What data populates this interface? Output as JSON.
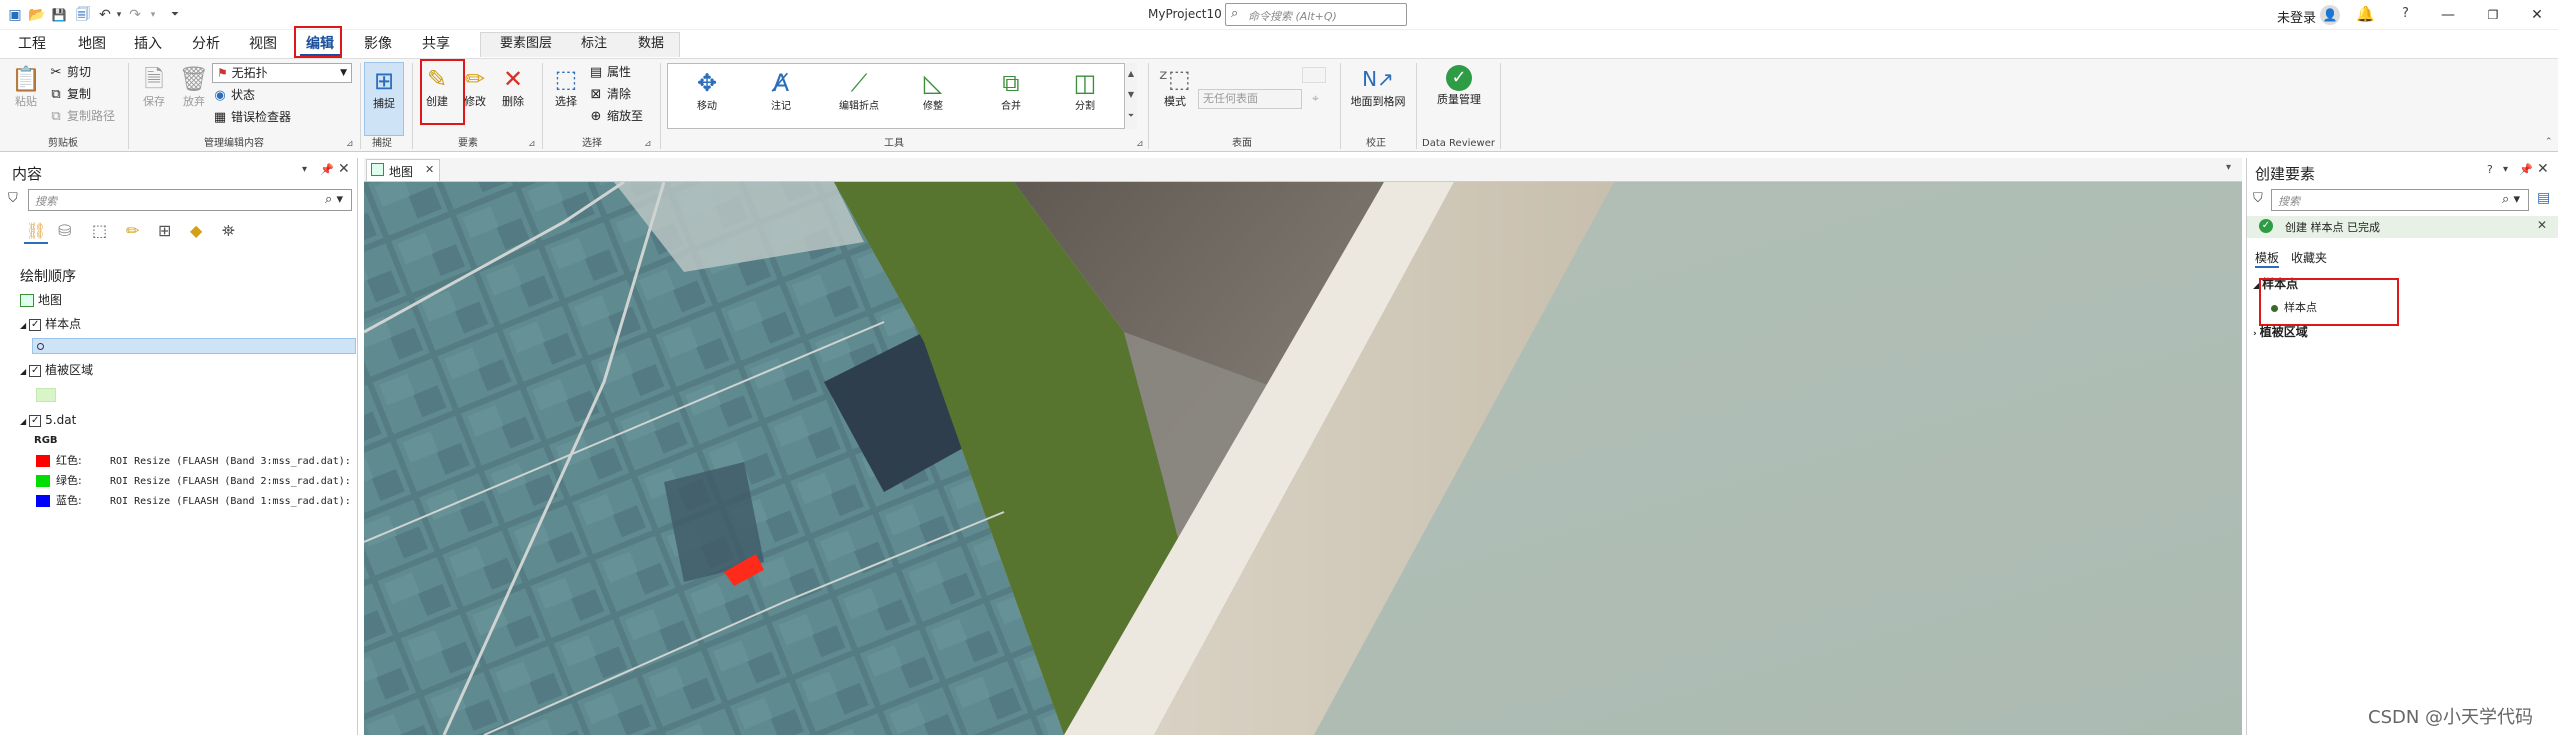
{
  "titlebar": {
    "app_title": "MyProject10",
    "command_search_placeholder": "命令搜索 (Alt+Q)",
    "user_status": "未登录",
    "help_label": "?"
  },
  "tabs": {
    "items": [
      "工程",
      "地图",
      "插入",
      "分析",
      "视图",
      "编辑",
      "影像",
      "共享"
    ],
    "active": "编辑",
    "contextual": [
      "要素图层",
      "标注",
      "数据"
    ]
  },
  "ribbon": {
    "clipboard": {
      "label": "剪贴板",
      "paste": "粘贴",
      "cut": "剪切",
      "copy": "复制",
      "copy_path": "复制路径"
    },
    "manage_edits": {
      "label": "管理编辑内容",
      "save": "保存",
      "discard": "放弃",
      "topology": "无拓扑",
      "status": "状态",
      "error_inspector": "错误检查器"
    },
    "snapping": {
      "label": "捕捉",
      "snap": "捕捉"
    },
    "features": {
      "label": "要素",
      "create": "创建",
      "modify": "修改",
      "delete": "删除"
    },
    "selection": {
      "label": "选择",
      "select": "选择",
      "attributes": "属性",
      "clear": "清除",
      "zoom_to": "缩放至"
    },
    "tools": {
      "label": "工具",
      "items": [
        "移动",
        "注记",
        "编辑折点",
        "修整",
        "合并",
        "分割"
      ]
    },
    "elevation": {
      "label": "表面",
      "mode": "模式",
      "surface_placeholder": "无任何表面"
    },
    "correction": {
      "label": "校正",
      "georef": "地面到格网"
    },
    "data_reviewer": {
      "label": "Data Reviewer",
      "quality": "质量管理"
    }
  },
  "contents": {
    "title": "内容",
    "search_placeholder": "搜索",
    "drawing_order": "绘制顺序",
    "map_name": "地图",
    "layers": [
      {
        "name": "样本点",
        "checked": true
      },
      {
        "name": "植被区域",
        "checked": true
      },
      {
        "name": "5.dat",
        "checked": true
      }
    ],
    "rgb_label": "RGB",
    "bands": [
      {
        "color": "#ff0000",
        "label": "红色:",
        "value": "ROI Resize (FLAASH (Band 3:mss_rad.dat):"
      },
      {
        "color": "#00dd00",
        "label": "绿色:",
        "value": "ROI Resize (FLAASH (Band 2:mss_rad.dat):"
      },
      {
        "color": "#0000ff",
        "label": "蓝色:",
        "value": "ROI Resize (FLAASH (Band 1:mss_rad.dat):"
      }
    ],
    "polygon_swatch": "#d9f5c8"
  },
  "map": {
    "tab_label": "地图"
  },
  "create_features": {
    "title": "创建要素",
    "search_placeholder": "搜索",
    "status_message": "创建 样本点 已完成",
    "tabs": [
      "模板",
      "收藏夹"
    ],
    "groups": [
      {
        "name": "样本点",
        "expanded": true,
        "items": [
          "样本点"
        ]
      },
      {
        "name": "植被区域",
        "expanded": false,
        "items": []
      }
    ]
  },
  "watermark": "CSDN @小天学代码"
}
